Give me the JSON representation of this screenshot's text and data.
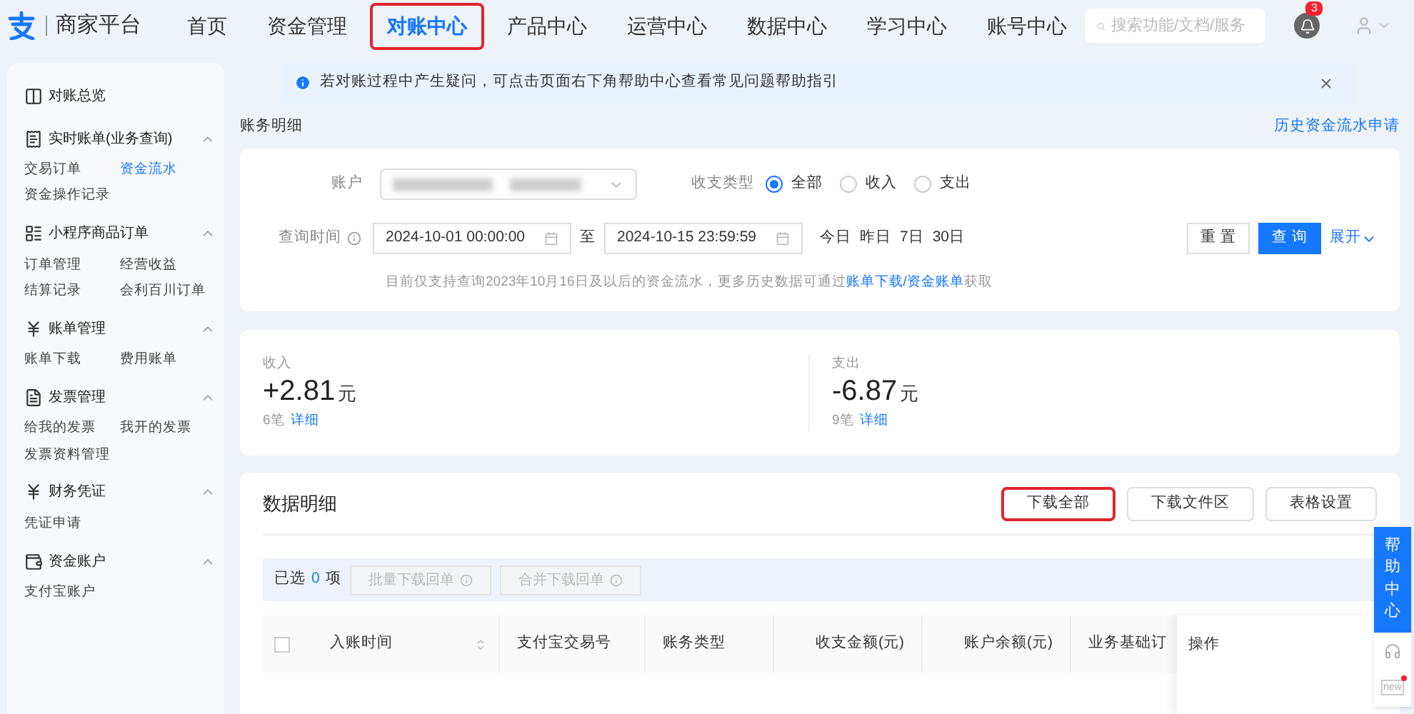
{
  "header": {
    "brand": "商家平台",
    "nav": [
      {
        "label": "首页",
        "selected": false,
        "highlighted": false
      },
      {
        "label": "资金管理",
        "selected": false,
        "highlighted": false
      },
      {
        "label": "对账中心",
        "selected": true,
        "highlighted": true
      },
      {
        "label": "产品中心",
        "selected": false,
        "highlighted": false
      },
      {
        "label": "运营中心",
        "selected": false,
        "highlighted": false
      },
      {
        "label": "数据中心",
        "selected": false,
        "highlighted": false
      },
      {
        "label": "学习中心",
        "selected": false,
        "highlighted": false
      },
      {
        "label": "账号中心",
        "selected": false,
        "highlighted": false
      }
    ],
    "search": {
      "placeholder": "搜索功能/文档/服务"
    },
    "notification_count": "3"
  },
  "sidebar": {
    "groups": [
      {
        "title": "对账总览"
      },
      {
        "title": "实时账单(业务查询)",
        "expanded": true,
        "items": [
          {
            "label": "交易订单",
            "selected": false
          },
          {
            "label": "资金流水",
            "selected": true
          },
          {
            "label": "资金操作记录",
            "selected": false
          }
        ]
      },
      {
        "title": "小程序商品订单",
        "expanded": true,
        "items": [
          {
            "label": "订单管理",
            "selected": false
          },
          {
            "label": "经营收益",
            "selected": false
          },
          {
            "label": "结算记录",
            "selected": false
          },
          {
            "label": "会利百川订单",
            "selected": false
          }
        ]
      },
      {
        "title": "账单管理",
        "expanded": true,
        "items": [
          {
            "label": "账单下载",
            "selected": false
          },
          {
            "label": "费用账单",
            "selected": false
          }
        ]
      },
      {
        "title": "发票管理",
        "expanded": true,
        "items": [
          {
            "label": "给我的发票",
            "selected": false
          },
          {
            "label": "我开的发票",
            "selected": false
          },
          {
            "label": "发票资料管理",
            "selected": false
          }
        ]
      },
      {
        "title": "财务凭证",
        "expanded": true,
        "items": [
          {
            "label": "凭证申请",
            "selected": false
          }
        ]
      },
      {
        "title": "资金账户",
        "expanded": true,
        "items": [
          {
            "label": "支付宝账户",
            "selected": false
          }
        ]
      }
    ]
  },
  "notice": {
    "text": "若对账过程中产生疑问，可点击页面右下角帮助中心查看常见问题帮助指引"
  },
  "page_title": "账务明细",
  "history_link": "历史资金流水申请",
  "filters": {
    "account_label": "账户",
    "type_label": "收支类型",
    "type_options": [
      {
        "label": "全部",
        "selected": true
      },
      {
        "label": "收入",
        "selected": false
      },
      {
        "label": "支出",
        "selected": false
      }
    ],
    "time_label": "查询时间",
    "start": "2024-10-01 00:00:00",
    "to": "至",
    "end": "2024-10-15 23:59:59",
    "quick_ranges": [
      "今日",
      "昨日",
      "7日",
      "30日"
    ],
    "reset": "重 置",
    "query": "查 询",
    "expand": "展开",
    "hint": "目前仅支持查询2023年10月16日及以后的资金流水，更多历史数据可通过",
    "hint_link": "账单下载/资金账单",
    "hint_tail": "获取"
  },
  "summary": [
    {
      "label": "收入",
      "amount": "+2.81",
      "unit": "元",
      "count": "6笔",
      "detail": "详细"
    },
    {
      "label": "支出",
      "amount": "-6.87",
      "unit": "元",
      "count": "9笔",
      "detail": "详细"
    }
  ],
  "data": {
    "title": "数据明细",
    "buttons": [
      {
        "label": "下载全部",
        "highlighted": true
      },
      {
        "label": "下载文件区",
        "highlighted": false
      },
      {
        "label": "表格设置",
        "highlighted": false
      }
    ],
    "selected_prefix": "已选",
    "selected_count": "0",
    "selected_suffix": "项",
    "batch_buttons": [
      {
        "label": "批量下载回单",
        "disabled": true
      },
      {
        "label": "合并下载回单",
        "disabled": true
      }
    ],
    "select_all_checked": false,
    "columns": [
      "入账时间",
      "支付宝交易号",
      "账务类型",
      "收支金额(元)",
      "账户余额(元)",
      "业务基础订",
      "操作"
    ]
  },
  "float": {
    "help": "帮助中心",
    "new": "new"
  }
}
